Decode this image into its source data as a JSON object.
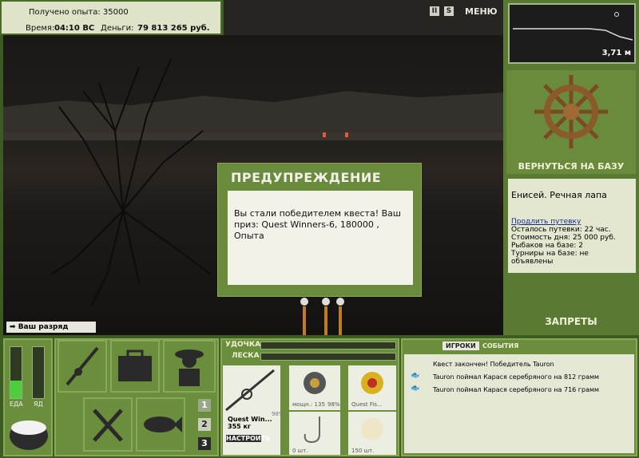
{
  "info": {
    "exp_label": "Получено опыта: 35000",
    "time_label": "Время:",
    "time_value": "04:10 ВС",
    "money_label": "Деньги:",
    "money_value": "79 813 265 руб."
  },
  "toolbar": {
    "pause_glyph": "II",
    "sound_glyph": "S",
    "menu_label": "МЕНЮ"
  },
  "minimap": {
    "depth": "3,71 м"
  },
  "base": {
    "return_label": "ВЕРНУТЬСЯ НА БАЗУ",
    "location": "Енисей. Речная лапа",
    "extend_link": "Продлить путевку",
    "remaining": "Осталось путевки: 22 час.",
    "cost": "Стоимость дня: 25 000 руб.",
    "fishers": "Рыбаков на базе: 2",
    "tournaments": "Турниры на базе: не объявлены",
    "bans_label": "ЗАПРЕТЫ"
  },
  "rank_msg": "Ваш разряд вырос!",
  "dialog": {
    "title": "ПРЕДУПРЕЖДЕНИЕ",
    "message": "Вы стали победителем квеста! Ваш приз: Quest Winners-6, 180000 , Опыта"
  },
  "meters": {
    "food_label": "ЕДА",
    "poison_label": "ЯД",
    "food_level": 0.35
  },
  "rod_panel": {
    "rod_label": "УДОЧКА",
    "line_label": "ЛЕСКА",
    "rod_name": "Quest Win...",
    "rod_weight": "355 кг",
    "setup_label": "НАСТРОИТЬ",
    "reel_power": "мощн.: 135",
    "reel_pct": "98%",
    "rod_pct": "98%",
    "line_name": "Quest Fis...",
    "hooks_count": "0 шт.",
    "bait_count": "150 шт."
  },
  "slots": [
    "1",
    "2",
    "3"
  ],
  "chat": {
    "tab_players": "ИГРОКИ",
    "tab_events": "СОБЫТИЯ",
    "events": [
      "Квест закончен! Победитель Tauron",
      "Tauron поймал Карася серебряного на 812 грамм",
      "Tauron поймал Карася серебряного на 716 грамм"
    ]
  }
}
